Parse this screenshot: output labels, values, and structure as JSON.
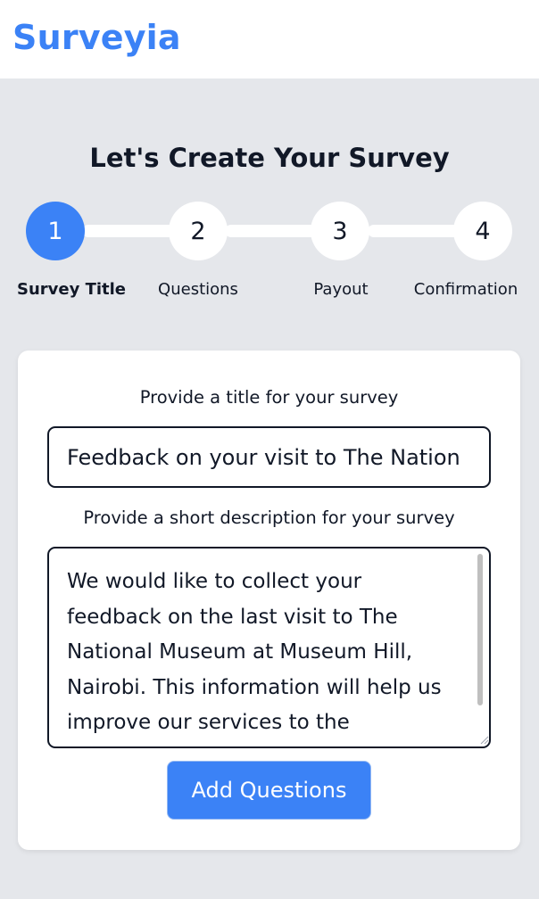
{
  "header": {
    "brand": "Surveyia"
  },
  "page": {
    "title": "Let's Create Your Survey"
  },
  "stepper": {
    "current_step": 1,
    "steps": [
      {
        "number": "1",
        "label": "Survey Title",
        "active": true
      },
      {
        "number": "2",
        "label": "Questions",
        "active": false
      },
      {
        "number": "3",
        "label": "Payout",
        "active": false
      },
      {
        "number": "4",
        "label": "Confirmation",
        "active": false
      }
    ]
  },
  "form": {
    "title_label": "Provide a title for your survey",
    "title_value": "Feedback on your visit to The Nation",
    "description_label": "Provide a short description for your survey",
    "description_value": "We would like to collect your feedback on the last visit to The National Museum at Museum Hill, Nairobi. This information will help us improve our services to the community.",
    "submit_label": "Add Questions"
  },
  "colors": {
    "brand": "#3b82f6",
    "active_step": "#3b82f6",
    "background": "#e5e7eb",
    "card": "#ffffff"
  }
}
